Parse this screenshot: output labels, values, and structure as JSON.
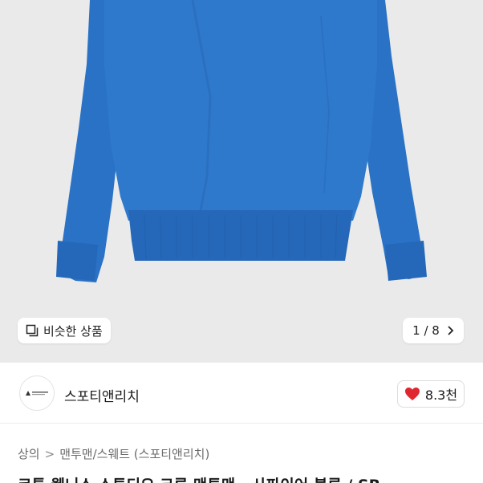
{
  "product_image": {
    "alt": "sweatshirt photo",
    "background": "#eaeaea",
    "garment_color": "#2a72c6"
  },
  "similar_button": {
    "label": "비슷한 상품",
    "icon": "similar-items-icon"
  },
  "pager": {
    "text": "1 / 8",
    "icon": "chevron-right-icon"
  },
  "seller": {
    "name": "스포티앤리치",
    "avatar_icon": "brand-logo-icon"
  },
  "like": {
    "count": "8.3천",
    "icon": "heart-icon",
    "color": "#e0262f"
  },
  "breadcrumb": {
    "items": [
      "상의",
      "맨투맨/스웨트 (스포티앤리치)"
    ],
    "separator": ">"
  },
  "product_title": "코튼 웰니스 스튜디오 크루 맨투맨 - 사파이어 블루 / SR"
}
